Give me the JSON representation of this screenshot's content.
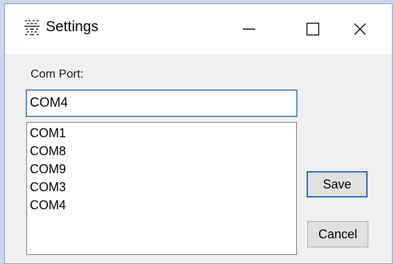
{
  "window": {
    "title": "Settings",
    "icons": {
      "app": "app-logo-icon",
      "minimize": "minimize-icon",
      "maximize": "maximize-icon",
      "close": "close-icon"
    }
  },
  "form": {
    "com_port_label": "Com Port:",
    "com_port_value": "COM4",
    "options": [
      "COM1",
      "COM8",
      "COM9",
      "COM3",
      "COM4"
    ]
  },
  "buttons": {
    "save_label": "Save",
    "cancel_label": "Cancel"
  },
  "colors": {
    "focus_border": "#5a8cc6",
    "default_button_border": "#2a6cc0",
    "titlebar_bg": "#ffffff",
    "dialog_bg": "#f0f0f0"
  }
}
